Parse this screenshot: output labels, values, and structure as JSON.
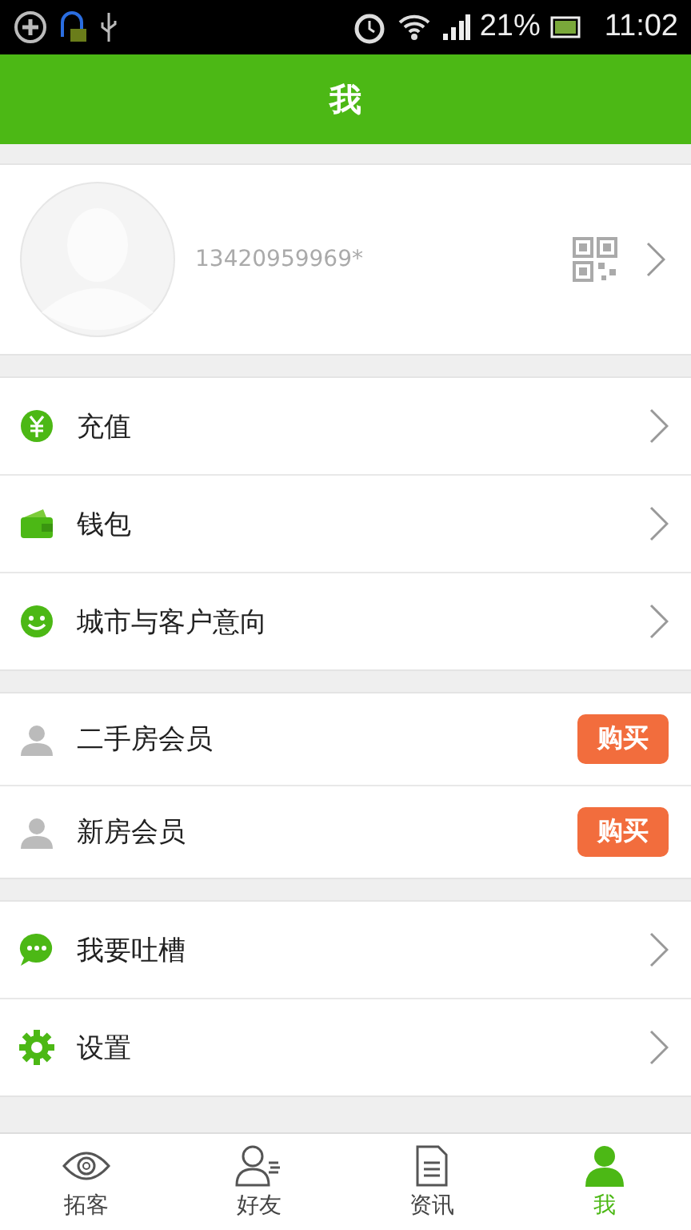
{
  "status_bar": {
    "battery": "21%",
    "time": "11:02"
  },
  "header": {
    "title": "我"
  },
  "profile": {
    "phone": "13420959969*"
  },
  "groups": [
    {
      "items": [
        {
          "label": "充值",
          "kind": "link"
        },
        {
          "label": "钱包",
          "kind": "link"
        },
        {
          "label": "城市与客户意向",
          "kind": "link"
        }
      ]
    },
    {
      "items": [
        {
          "label": "二手房会员",
          "kind": "purchase",
          "button": "购买"
        },
        {
          "label": "新房会员",
          "kind": "purchase",
          "button": "购买"
        }
      ]
    },
    {
      "items": [
        {
          "label": "我要吐槽",
          "kind": "link"
        },
        {
          "label": "设置",
          "kind": "link"
        }
      ]
    }
  ],
  "tabs": [
    {
      "label": "拓客",
      "selected": false
    },
    {
      "label": "好友",
      "selected": false
    },
    {
      "label": "资讯",
      "selected": false
    },
    {
      "label": "我",
      "selected": true
    }
  ]
}
